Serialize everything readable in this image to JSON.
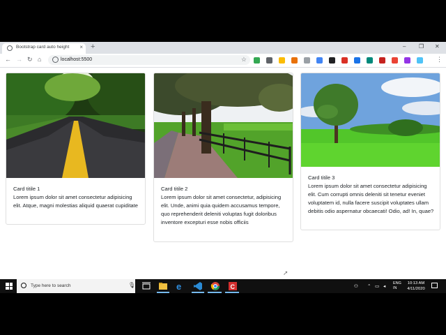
{
  "browser": {
    "tab_title": "Bootstrap card auto height",
    "tab_close": "×",
    "new_tab": "+",
    "window_controls": [
      "–",
      "❐",
      "✕"
    ],
    "url": "localhost:5500",
    "nav": {
      "back": "←",
      "forward": "→",
      "reload": "↻",
      "home": "⌂"
    },
    "star": "☆",
    "menu": "⋮",
    "extensions": [
      {
        "name": "ext-green-icon",
        "color": "#34a853"
      },
      {
        "name": "ext-pen-icon",
        "color": "#5f6368"
      },
      {
        "name": "ext-pin-icon",
        "color": "#fbbc05"
      },
      {
        "name": "ext-orange-icon",
        "color": "#e8710a"
      },
      {
        "name": "ext-cursor-icon",
        "color": "#9aa0a6"
      },
      {
        "name": "ext-doc-icon",
        "color": "#4285f4"
      },
      {
        "name": "ext-dark-icon",
        "color": "#202124"
      },
      {
        "name": "ext-red-icon",
        "color": "#d93025"
      },
      {
        "name": "ext-blue-icon",
        "color": "#1a73e8"
      },
      {
        "name": "ext-teal-icon",
        "color": "#00897b"
      },
      {
        "name": "ext-red2-icon",
        "color": "#c5221f"
      },
      {
        "name": "ext-chrome-icon",
        "color": "#ea4335"
      },
      {
        "name": "ext-purple-icon",
        "color": "#9334e6"
      },
      {
        "name": "ext-lightblue-icon",
        "color": "#4fc3f7"
      }
    ]
  },
  "cards": [
    {
      "title": "Card titile 1",
      "text": "Lorem ipsum dolor sit amet consectetur adipisicing elit. Atque, magni molestias aliquid quaerat cupiditate"
    },
    {
      "title": "Card titile 2",
      "text": "Lorem ipsum dolor sit amet consectetur, adipisicing elit. Unde, animi quia quidem accusamus tempore, quo reprehenderit deleniti voluptas fugit doloribus inventore excepturi esse nobis officiis"
    },
    {
      "title": "Card titile 3",
      "text": "Lorem ipsum dolor sit amet consectetur adipisicing elit. Cum corrupti omnis deleniti sit tenetur eveniet voluptatem id, nulla facere suscipit voluptates ullam debitis odio aspernatur obcaecati! Odio, ad! In, quae?"
    }
  ],
  "taskbar": {
    "search_placeholder": "Type here to search",
    "lang_line1": "ENG",
    "lang_line2": "IN",
    "time": "10:13 AM",
    "date": "4/11/2020"
  }
}
